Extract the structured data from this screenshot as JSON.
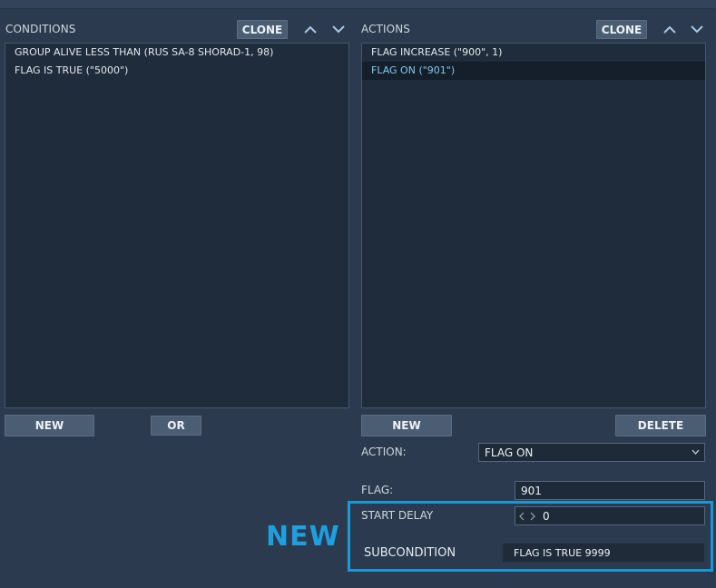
{
  "conditions": {
    "label": "CONDITIONS",
    "clone_label": "CLONE",
    "items": [
      "GROUP ALIVE LESS THAN (RUS SA-8 SHORAD-1, 98)",
      "FLAG IS TRUE (\"5000\")"
    ],
    "new_label": "NEW",
    "or_label": "OR"
  },
  "actions": {
    "label": "ACTIONS",
    "clone_label": "CLONE",
    "items": [
      "FLAG INCREASE (\"900\", 1)",
      "FLAG ON (\"901\")"
    ],
    "selected_index": 1,
    "new_label": "NEW",
    "delete_label": "DELETE"
  },
  "form": {
    "action_label": "ACTION:",
    "action_value": "FLAG ON",
    "flag_label": "FLAG:",
    "flag_value": "901",
    "start_delay_label": "START DELAY",
    "start_delay_value": "0",
    "subcondition_label": "SUBCONDITION",
    "subcondition_value": "FLAG IS TRUE 9999"
  },
  "annotation": {
    "new_text": "NEW",
    "color": "#1b97d6"
  },
  "icons": [
    "chevron-up-icon",
    "chevron-down-icon",
    "dropdown-chevron-icon",
    "stepper-arrows-icon"
  ]
}
